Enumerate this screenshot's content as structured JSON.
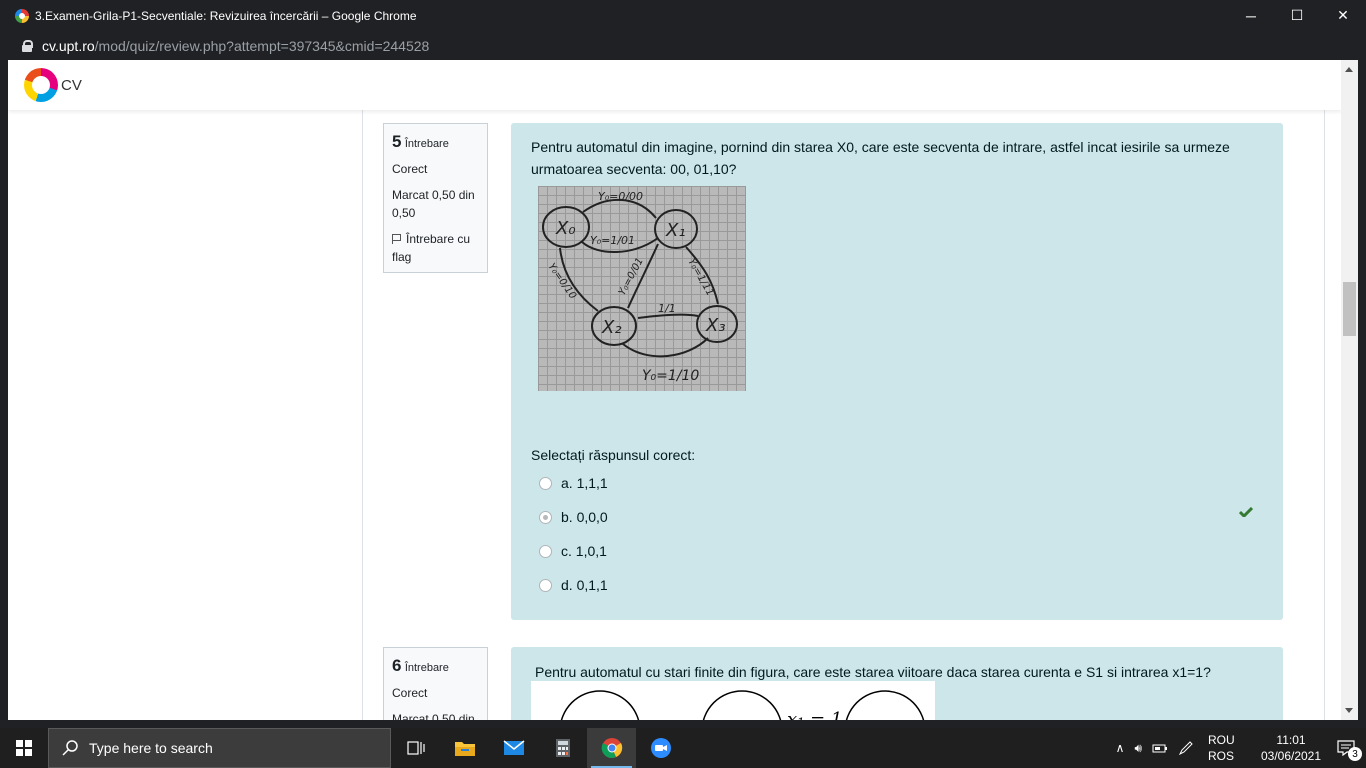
{
  "browser": {
    "title": "3.Examen-Grila-P1-Secventiale: Revizuirea încercării – Google Chrome",
    "url_host": "cv.upt.ro",
    "url_path": "/mod/quiz/review.php?attempt=397345&cmid=244528",
    "minimize": "─",
    "maximize": "☐",
    "close": "✕"
  },
  "site": {
    "brand": "CV"
  },
  "question5": {
    "number": "5",
    "word": "Întrebare",
    "status": "Corect",
    "mark": "Marcat 0,50 din 0,50",
    "flag_label": "Întrebare cu flag",
    "text": "Pentru automatul din imagine, pornind din starea X0, care este secventa de intrare, astfel incat iesirile sa urmeze urmatoarea secventa: 00, 01,10?",
    "diagram_labels": {
      "x0": "X₀",
      "x1": "X₁",
      "x2": "X₂",
      "x3": "X₃",
      "e01": "Y₀=0/00",
      "e10": "Y₀=1/01",
      "e13": "Y₀=1/11",
      "e12": "Y₀=0/01",
      "e20": "Y₀=0/10",
      "e32": "1/1",
      "e23": "Y₀=1/10"
    },
    "prompt": "Selectați răspunsul corect:",
    "options": [
      {
        "label": "a. 1,1,1",
        "checked": false
      },
      {
        "label": "b. 0,0,0",
        "checked": true
      },
      {
        "label": "c. 1,0,1",
        "checked": false
      },
      {
        "label": "d. 0,1,1",
        "checked": false
      }
    ],
    "correct_color": "#357a32"
  },
  "question6": {
    "number": "6",
    "word": "Întrebare",
    "status": "Corect",
    "mark": "Marcat 0,50 din",
    "text": "Pentru automatul cu stari finite din figura, care este starea viitoare daca starea curenta e S1 si intrarea x1=1?",
    "image_formula": "x₁ = 1"
  },
  "taskbar": {
    "search_placeholder": "Type here to search",
    "lang1": "ROU",
    "lang2": "ROS",
    "time": "11:01",
    "date": "03/06/2021",
    "notifications": "3"
  },
  "colors": {
    "question_bg": "#cce6ea",
    "info_bg": "#f8f9fa",
    "chrome_bg": "#202124",
    "taskbar_bg": "#1f1f1f"
  }
}
